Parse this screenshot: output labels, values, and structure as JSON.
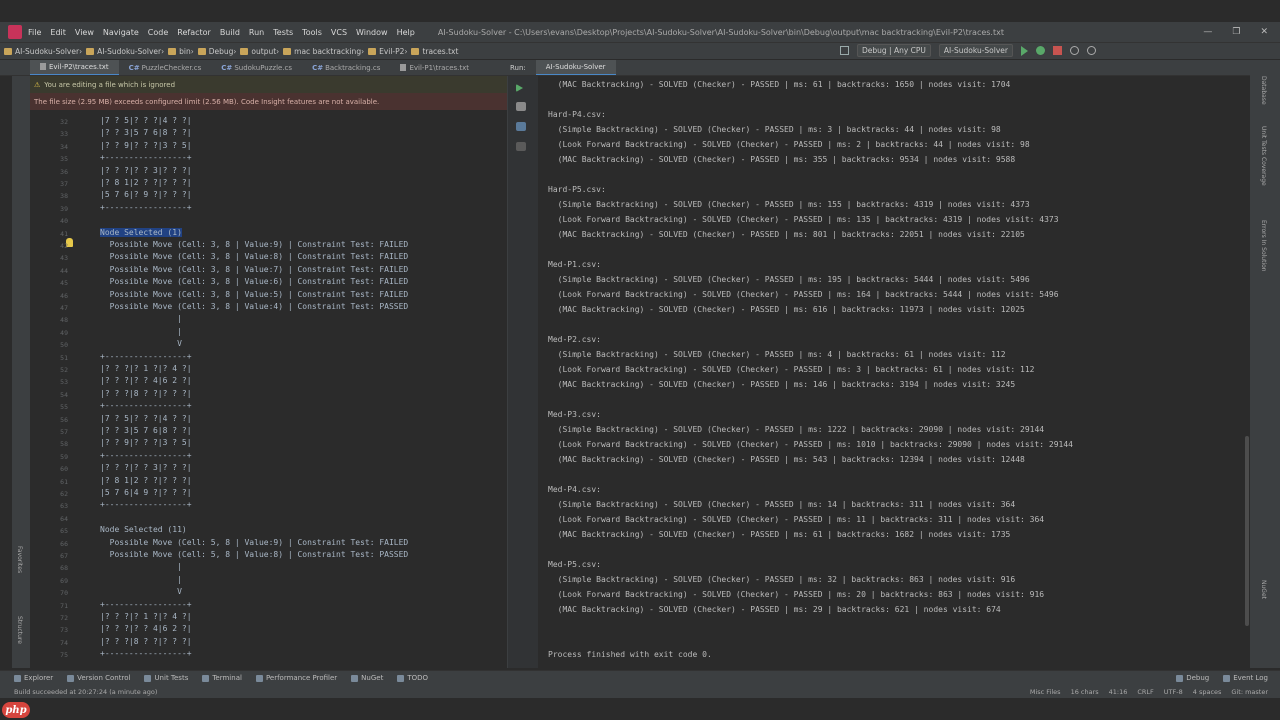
{
  "title_bar": {
    "menu": [
      "File",
      "Edit",
      "View",
      "Navigate",
      "Code",
      "Refactor",
      "Build",
      "Run",
      "Tests",
      "Tools",
      "VCS",
      "Window",
      "Help"
    ],
    "title": "AI-Sudoku-Solver - C:\\Users\\evans\\Desktop\\Projects\\AI-Sudoku-Solver\\AI-Sudoku-Solver\\bin\\Debug\\output\\mac backtracking\\Evil-P2\\traces.txt"
  },
  "breadcrumbs": [
    "AI-Sudoku-Solver",
    "AI-Sudoku-Solver",
    "bin",
    "Debug",
    "output",
    "mac backtracking",
    "Evil-P2",
    "traces.txt"
  ],
  "run_config": {
    "configuration": "Debug | Any CPU",
    "project": "AI-Sudoku-Solver"
  },
  "editor_tabs": [
    {
      "label": "Evil-P2\\traces.txt",
      "cs": false,
      "active": true
    },
    {
      "label": "PuzzleChecker.cs",
      "cs": true
    },
    {
      "label": "SudokuPuzzle.cs",
      "cs": true
    },
    {
      "label": "Backtracking.cs",
      "cs": true
    },
    {
      "label": "Evil-P1\\traces.txt",
      "cs": false
    }
  ],
  "run_tabs": {
    "label": "Run:",
    "tab": "AI-Sudoku-Solver"
  },
  "notices": [
    "You are editing a file which is ignored",
    "The file size (2.95 MB) exceeds configured limit (2.56 MB). Code Insight features are not available."
  ],
  "editor_lines": [
    {
      "n": "32",
      "t": "|7 ? 5|? ? ?|4 ? ?|"
    },
    {
      "n": "33",
      "t": "|? ? 3|5 7 6|8 ? ?|"
    },
    {
      "n": "34",
      "t": "|? ? 9|? ? ?|3 ? 5|"
    },
    {
      "n": "35",
      "t": "+-----------------+"
    },
    {
      "n": "36",
      "t": "|? ? ?|? ? 3|? ? ?|"
    },
    {
      "n": "37",
      "t": "|? 8 1|2 ? ?|? ? ?|"
    },
    {
      "n": "38",
      "t": "|5 7 6|? 9 ?|? ? ?|"
    },
    {
      "n": "39",
      "t": "+-----------------+"
    },
    {
      "n": "40",
      "t": ""
    },
    {
      "n": "41",
      "t": "Node Selected (1)"
    },
    {
      "n": "42",
      "t": "  Possible Move (Cell: 3, 8 | Value:9) | Constraint Test: FAILED"
    },
    {
      "n": "43",
      "t": "  Possible Move (Cell: 3, 8 | Value:8) | Constraint Test: FAILED"
    },
    {
      "n": "44",
      "t": "  Possible Move (Cell: 3, 8 | Value:7) | Constraint Test: FAILED"
    },
    {
      "n": "45",
      "t": "  Possible Move (Cell: 3, 8 | Value:6) | Constraint Test: FAILED"
    },
    {
      "n": "46",
      "t": "  Possible Move (Cell: 3, 8 | Value:5) | Constraint Test: FAILED"
    },
    {
      "n": "47",
      "t": "  Possible Move (Cell: 3, 8 | Value:4) | Constraint Test: PASSED"
    },
    {
      "n": "48",
      "t": "                |"
    },
    {
      "n": "49",
      "t": "                |"
    },
    {
      "n": "50",
      "t": "                V"
    },
    {
      "n": "51",
      "t": "+-----------------+"
    },
    {
      "n": "52",
      "t": "|? ? ?|? 1 ?|? 4 ?|"
    },
    {
      "n": "53",
      "t": "|? ? ?|? ? 4|6 2 ?|"
    },
    {
      "n": "54",
      "t": "|? ? ?|8 ? ?|? ? ?|"
    },
    {
      "n": "55",
      "t": "+-----------------+"
    },
    {
      "n": "56",
      "t": "|7 ? 5|? ? ?|4 ? ?|"
    },
    {
      "n": "57",
      "t": "|? ? 3|5 7 6|8 ? ?|"
    },
    {
      "n": "58",
      "t": "|? ? 9|? ? ?|3 ? 5|"
    },
    {
      "n": "59",
      "t": "+-----------------+"
    },
    {
      "n": "60",
      "t": "|? ? ?|? ? 3|? ? ?|"
    },
    {
      "n": "61",
      "t": "|? 8 1|2 ? ?|? ? ?|"
    },
    {
      "n": "62",
      "t": "|5 7 6|4 9 ?|? ? ?|"
    },
    {
      "n": "63",
      "t": "+-----------------+"
    },
    {
      "n": "64",
      "t": ""
    },
    {
      "n": "65",
      "t": "Node Selected (11)"
    },
    {
      "n": "66",
      "t": "  Possible Move (Cell: 5, 8 | Value:9) | Constraint Test: FAILED"
    },
    {
      "n": "67",
      "t": "  Possible Move (Cell: 5, 8 | Value:8) | Constraint Test: PASSED"
    },
    {
      "n": "68",
      "t": "                |"
    },
    {
      "n": "69",
      "t": "                |"
    },
    {
      "n": "70",
      "t": "                V"
    },
    {
      "n": "71",
      "t": "+-----------------+"
    },
    {
      "n": "72",
      "t": "|? ? ?|? 1 ?|? 4 ?|"
    },
    {
      "n": "73",
      "t": "|? ? ?|? ? 4|6 2 ?|"
    },
    {
      "n": "74",
      "t": "|? ? ?|8 ? ?|? ? ?|"
    },
    {
      "n": "75",
      "t": "+-----------------+"
    }
  ],
  "selected_text": "Node Selected (1)",
  "run_output": [
    "  (MAC Backtracking) - SOLVED (Checker) - PASSED | ms: 61 | backtracks: 1650 | nodes visit: 1704",
    "",
    "Hard-P4.csv:",
    "  (Simple Backtracking) - SOLVED (Checker) - PASSED | ms: 3 | backtracks: 44 | nodes visit: 98",
    "  (Look Forward Backtracking) - SOLVED (Checker) - PASSED | ms: 2 | backtracks: 44 | nodes visit: 98",
    "  (MAC Backtracking) - SOLVED (Checker) - PASSED | ms: 355 | backtracks: 9534 | nodes visit: 9588",
    "",
    "Hard-P5.csv:",
    "  (Simple Backtracking) - SOLVED (Checker) - PASSED | ms: 155 | backtracks: 4319 | nodes visit: 4373",
    "  (Look Forward Backtracking) - SOLVED (Checker) - PASSED | ms: 135 | backtracks: 4319 | nodes visit: 4373",
    "  (MAC Backtracking) - SOLVED (Checker) - PASSED | ms: 801 | backtracks: 22051 | nodes visit: 22105",
    "",
    "Med-P1.csv:",
    "  (Simple Backtracking) - SOLVED (Checker) - PASSED | ms: 195 | backtracks: 5444 | nodes visit: 5496",
    "  (Look Forward Backtracking) - SOLVED (Checker) - PASSED | ms: 164 | backtracks: 5444 | nodes visit: 5496",
    "  (MAC Backtracking) - SOLVED (Checker) - PASSED | ms: 616 | backtracks: 11973 | nodes visit: 12025",
    "",
    "Med-P2.csv:",
    "  (Simple Backtracking) - SOLVED (Checker) - PASSED | ms: 4 | backtracks: 61 | nodes visit: 112",
    "  (Look Forward Backtracking) - SOLVED (Checker) - PASSED | ms: 3 | backtracks: 61 | nodes visit: 112",
    "  (MAC Backtracking) - SOLVED (Checker) - PASSED | ms: 146 | backtracks: 3194 | nodes visit: 3245",
    "",
    "Med-P3.csv:",
    "  (Simple Backtracking) - SOLVED (Checker) - PASSED | ms: 1222 | backtracks: 29090 | nodes visit: 29144",
    "  (Look Forward Backtracking) - SOLVED (Checker) - PASSED | ms: 1010 | backtracks: 29090 | nodes visit: 29144",
    "  (MAC Backtracking) - SOLVED (Checker) - PASSED | ms: 543 | backtracks: 12394 | nodes visit: 12448",
    "",
    "Med-P4.csv:",
    "  (Simple Backtracking) - SOLVED (Checker) - PASSED | ms: 14 | backtracks: 311 | nodes visit: 364",
    "  (Look Forward Backtracking) - SOLVED (Checker) - PASSED | ms: 11 | backtracks: 311 | nodes visit: 364",
    "  (MAC Backtracking) - SOLVED (Checker) - PASSED | ms: 61 | backtracks: 1682 | nodes visit: 1735",
    "",
    "Med-P5.csv:",
    "  (Simple Backtracking) - SOLVED (Checker) - PASSED | ms: 32 | backtracks: 863 | nodes visit: 916",
    "  (Look Forward Backtracking) - SOLVED (Checker) - PASSED | ms: 20 | backtracks: 863 | nodes visit: 916",
    "  (MAC Backtracking) - SOLVED (Checker) - PASSED | ms: 29 | backtracks: 621 | nodes visit: 674",
    "",
    "",
    "Process finished with exit code 0."
  ],
  "right_strip_labels": [
    "Database",
    "Unit Tests Coverage",
    "Errors In Solution",
    "NuGet"
  ],
  "left_strip_labels": [
    "Structure",
    "Favorites"
  ],
  "tool_windows": [
    "Explorer",
    "Version Control",
    "Unit Tests",
    "Terminal",
    "Performance Profiler",
    "NuGet",
    "TODO"
  ],
  "tool_windows_right": [
    "Debug",
    "Event Log"
  ],
  "status": {
    "message": "Build succeeded at 20:27:24 (a minute ago)",
    "misc": "Misc Files",
    "chars": "16 chars",
    "position": "41:16",
    "line_sep": "CRLF",
    "encoding": "UTF-8",
    "indent": "4 spaces",
    "vcs": "Git: master"
  },
  "watermark": "php",
  "colors": {
    "editor_bg": "#2b2b2b",
    "chrome_bg": "#3c3f41",
    "selection": "#214283",
    "text": "#a9b7c6",
    "accent_tab": "#4a88c7"
  }
}
